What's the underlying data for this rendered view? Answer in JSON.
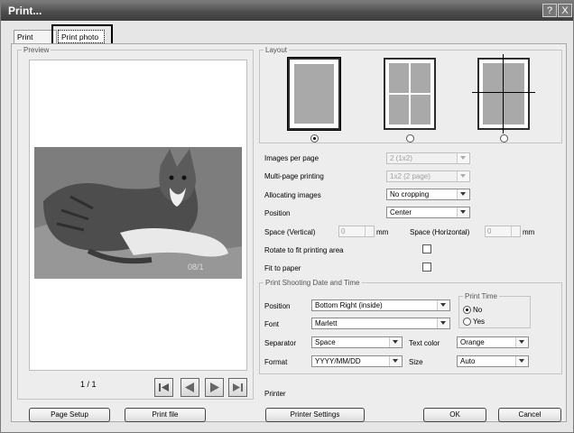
{
  "window": {
    "title": "Print...",
    "help_btn": "?",
    "close_btn": "X"
  },
  "tabs": [
    {
      "label": "Print Index"
    },
    {
      "label": "Print photo"
    }
  ],
  "preview": {
    "legend": "Preview",
    "page_indicator": "1 / 1",
    "photo_stamp": "08/1"
  },
  "layout": {
    "legend": "Layout",
    "selected_index": 0,
    "options": [
      {
        "name": "single"
      },
      {
        "name": "grid-2x2"
      },
      {
        "name": "quadrants"
      }
    ]
  },
  "settings": {
    "images_per_page": {
      "label": "Images per page",
      "value": "2 (1x2)"
    },
    "multipage": {
      "label": "Multi-page printing",
      "value": "1x2 (2 page)"
    },
    "allocating": {
      "label": "Allocating images",
      "value": "No cropping"
    },
    "position": {
      "label": "Position",
      "value": "Center"
    },
    "space_v": {
      "label": "Space (Vertical)",
      "value": "0",
      "unit": "mm"
    },
    "space_h": {
      "label": "Space (Horizontal)",
      "value": "0",
      "unit": "mm"
    },
    "rotate": {
      "label": "Rotate to fit printing area",
      "checked": false
    },
    "fit": {
      "label": "Fit to paper",
      "checked": false
    }
  },
  "shooting": {
    "legend": "Print Shooting Date and Time",
    "position": {
      "label": "Position",
      "value": "Bottom Right (inside)"
    },
    "font": {
      "label": "Font",
      "value": "Marlett"
    },
    "separator": {
      "label": "Separator",
      "value": "Space"
    },
    "text_color": {
      "label": "Text color",
      "value": "Orange"
    },
    "format": {
      "label": "Format",
      "value": "YYYY/MM/DD"
    },
    "size": {
      "label": "Size",
      "value": "Auto"
    },
    "print_time": {
      "legend": "Print Time",
      "no": "No",
      "yes": "Yes",
      "selected": "No"
    }
  },
  "printer": {
    "label": "Printer"
  },
  "buttons": {
    "page_setup": "Page Setup",
    "print_file": "Print file",
    "printer_settings": "Printer Settings",
    "ok": "OK",
    "cancel": "Cancel"
  }
}
